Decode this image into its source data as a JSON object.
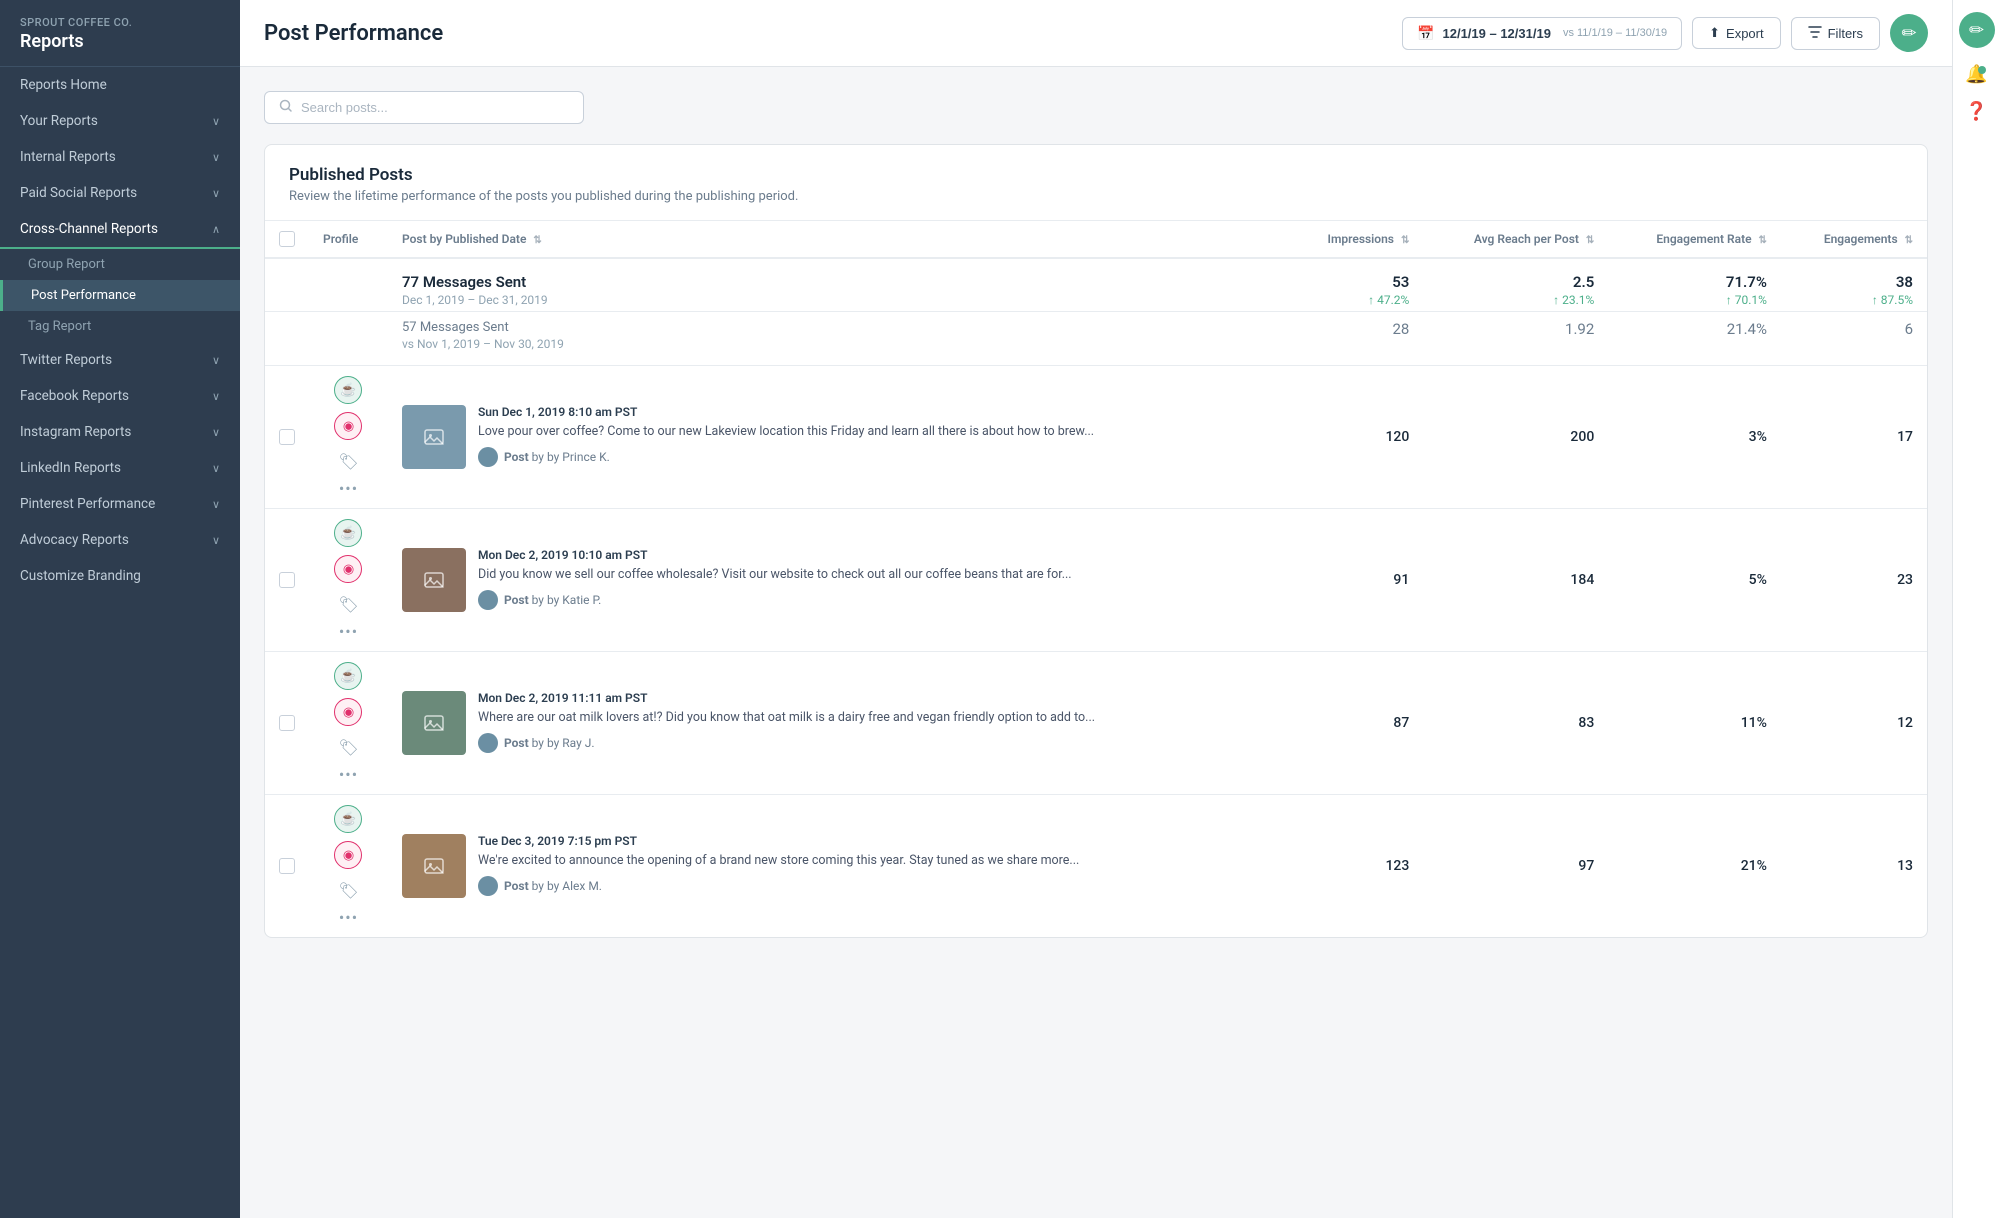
{
  "app": {
    "company": "Sprout Coffee Co.",
    "section": "Reports"
  },
  "sidebar": {
    "top_items": [
      {
        "id": "reports-home",
        "label": "Reports Home",
        "expandable": false
      },
      {
        "id": "your-reports",
        "label": "Your Reports",
        "expandable": true
      },
      {
        "id": "internal-reports",
        "label": "Internal Reports",
        "expandable": true
      },
      {
        "id": "paid-social-reports",
        "label": "Paid Social Reports",
        "expandable": true
      },
      {
        "id": "cross-channel-reports",
        "label": "Cross-Channel Reports",
        "expandable": true,
        "active": true
      }
    ],
    "cross_channel_sub": [
      {
        "id": "group-report",
        "label": "Group Report"
      },
      {
        "id": "post-performance",
        "label": "Post Performance",
        "active": true
      },
      {
        "id": "tag-report",
        "label": "Tag Report"
      }
    ],
    "bottom_items": [
      {
        "id": "twitter-reports",
        "label": "Twitter Reports",
        "expandable": true
      },
      {
        "id": "facebook-reports",
        "label": "Facebook Reports",
        "expandable": true
      },
      {
        "id": "instagram-reports",
        "label": "Instagram Reports",
        "expandable": true
      },
      {
        "id": "linkedin-reports",
        "label": "LinkedIn Reports",
        "expandable": true
      },
      {
        "id": "pinterest-performance",
        "label": "Pinterest Performance",
        "expandable": true
      },
      {
        "id": "advocacy-reports",
        "label": "Advocacy Reports",
        "expandable": true
      },
      {
        "id": "customize-branding",
        "label": "Customize Branding",
        "expandable": false
      }
    ]
  },
  "header": {
    "page_title": "Post Performance",
    "date_range": "12/1/19 – 12/31/19",
    "vs_date": "vs 11/1/19 – 11/30/19",
    "export_label": "Export",
    "filters_label": "Filters"
  },
  "search": {
    "placeholder": "Search posts..."
  },
  "published_posts": {
    "title": "Published Posts",
    "description": "Review the lifetime performance of the posts you published during the publishing period.",
    "columns": {
      "profile": "Profile",
      "post_by_date": "Post by Published Date",
      "impressions": "Impressions",
      "avg_reach": "Avg Reach per Post",
      "engagement_rate": "Engagement Rate",
      "engagements": "Engagements"
    },
    "summary_current": {
      "label": "77 Messages Sent",
      "date": "Dec 1, 2019 – Dec 31, 2019",
      "impressions": "53",
      "impressions_delta": "↑ 47.2%",
      "avg_reach": "2.5",
      "avg_reach_delta": "↑ 23.1%",
      "engagement_rate": "71.7%",
      "engagement_rate_delta": "↑ 70.1%",
      "engagements": "38",
      "engagements_delta": "↑ 87.5%"
    },
    "summary_prev": {
      "label": "57 Messages Sent",
      "date": "vs Nov 1, 2019 – Nov 30, 2019",
      "impressions": "28",
      "avg_reach": "1.92",
      "engagement_rate": "21.4%",
      "engagements": "6"
    },
    "posts": [
      {
        "id": 1,
        "date": "Sun Dec 1, 2019 8:10 am PST",
        "text": "Love pour over coffee? Come to our new Lakeview location this Friday and learn all there is about how to brew...",
        "author": "Post by Prince K.",
        "impressions": "120",
        "avg_reach": "200",
        "engagement_rate": "3%",
        "engagements": "17",
        "thumb_color": "#7a9aad"
      },
      {
        "id": 2,
        "date": "Mon Dec 2, 2019 10:10 am PST",
        "text": "Did you know we sell our coffee wholesale? Visit our website to check out all our coffee beans that are for...",
        "author": "Post by Katie P.",
        "impressions": "91",
        "avg_reach": "184",
        "engagement_rate": "5%",
        "engagements": "23",
        "thumb_color": "#8a7060"
      },
      {
        "id": 3,
        "date": "Mon Dec 2, 2019 11:11 am PST",
        "text": "Where are our oat milk lovers at!? Did you know that oat milk is a dairy free and vegan friendly option to add to...",
        "author": "Post by Ray J.",
        "impressions": "87",
        "avg_reach": "83",
        "engagement_rate": "11%",
        "engagements": "12",
        "thumb_color": "#6b8a7a"
      },
      {
        "id": 4,
        "date": "Tue Dec 3, 2019 7:15 pm PST",
        "text": "We're excited to announce the opening of a brand new store coming this year. Stay tuned as we share more...",
        "author": "Post by Alex M.",
        "impressions": "123",
        "avg_reach": "97",
        "engagement_rate": "21%",
        "engagements": "13",
        "thumb_color": "#a08060"
      }
    ]
  },
  "icons": {
    "search": "🔍",
    "calendar": "📅",
    "export": "⬆",
    "filters": "⚙",
    "compose": "✏",
    "bell": "🔔",
    "help": "❓",
    "chevron": "›",
    "sort": "⇅",
    "coffee_cup": "☕",
    "instagram": "◉",
    "tag": "🏷",
    "more": "•••",
    "check": "✓"
  },
  "colors": {
    "brand_green": "#4CAF8A",
    "sidebar_bg": "#2e3d4f",
    "active_item": "#3d5166",
    "delta_up": "#4CAF8A"
  }
}
